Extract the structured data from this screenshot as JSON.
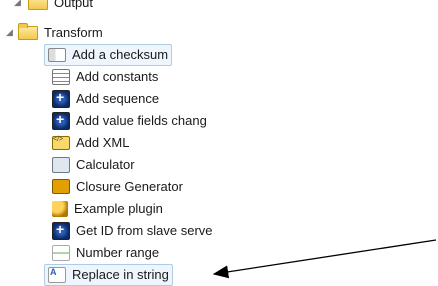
{
  "tree": {
    "partial_category": {
      "label": "Output"
    },
    "category": {
      "label": "Transform",
      "expanded": true
    },
    "steps": [
      {
        "label": "Add a checksum",
        "icon": "checksum-icon"
      },
      {
        "label": "Add constants",
        "icon": "constants-icon"
      },
      {
        "label": "Add sequence",
        "icon": "sequence-icon"
      },
      {
        "label": "Add value fields chang",
        "icon": "sequence-icon"
      },
      {
        "label": "Add XML",
        "icon": "xml-icon"
      },
      {
        "label": "Calculator",
        "icon": "calculator-icon"
      },
      {
        "label": "Closure Generator",
        "icon": "closure-icon"
      },
      {
        "label": "Example plugin",
        "icon": "plugin-icon"
      },
      {
        "label": "Get ID from slave serve",
        "icon": "sequence-icon"
      },
      {
        "label": "Number range",
        "icon": "number-range-icon"
      },
      {
        "label": "Replace in string",
        "icon": "replace-icon"
      }
    ]
  },
  "colors": {
    "highlight_border": "#aecbe8",
    "highlight_bg": "#eef5fd",
    "folder": "#f2c94c"
  }
}
